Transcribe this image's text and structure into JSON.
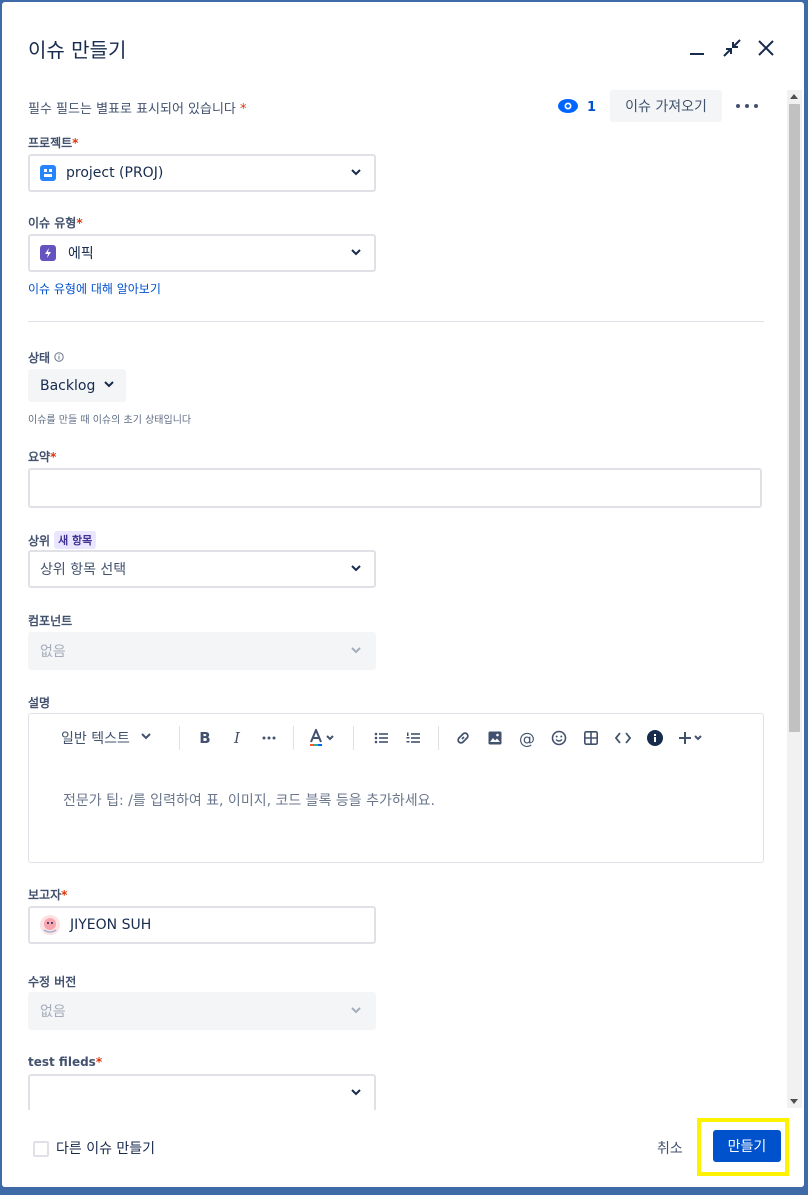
{
  "modal": {
    "title": "이슈 만들기"
  },
  "header": {
    "required_note": "필수 필드는 별표로 표시되어 있습니다",
    "required_star": "*",
    "watchers_count": "1",
    "import_issues_label": "이슈 가져오기"
  },
  "fields": {
    "project": {
      "label": "프로젝트",
      "value": "project (PROJ)"
    },
    "issue_type": {
      "label": "이슈 유형",
      "value": "에픽",
      "learn_more": "이슈 유형에 대해 알아보기"
    },
    "status": {
      "label": "상태",
      "value": "Backlog",
      "help": "이슈를 만들 때 이슈의 초기 상태입니다"
    },
    "summary": {
      "label": "요약",
      "value": ""
    },
    "parent": {
      "label": "상위",
      "badge": "새 항목",
      "placeholder": "상위 항목 선택"
    },
    "components": {
      "label": "컴포넌트",
      "placeholder": "없음"
    },
    "description": {
      "label": "설명",
      "text_style": "일반 텍스트",
      "placeholder": "전문가 팁: /를 입력하여 표, 이미지, 코드 블록 등을 추가하세요."
    },
    "reporter": {
      "label": "보고자",
      "value": "JIYEON SUH"
    },
    "fix_version": {
      "label": "수정 버전",
      "placeholder": "없음"
    },
    "test_field": {
      "label": "test fileds",
      "value": ""
    }
  },
  "footer": {
    "create_another_label": "다른 이슈 만들기",
    "cancel_label": "취소",
    "create_label": "만들기"
  },
  "colors": {
    "primary": "#0052cc",
    "required": "#de350b",
    "highlight": "#fff200",
    "background": "#3f6aa8"
  }
}
